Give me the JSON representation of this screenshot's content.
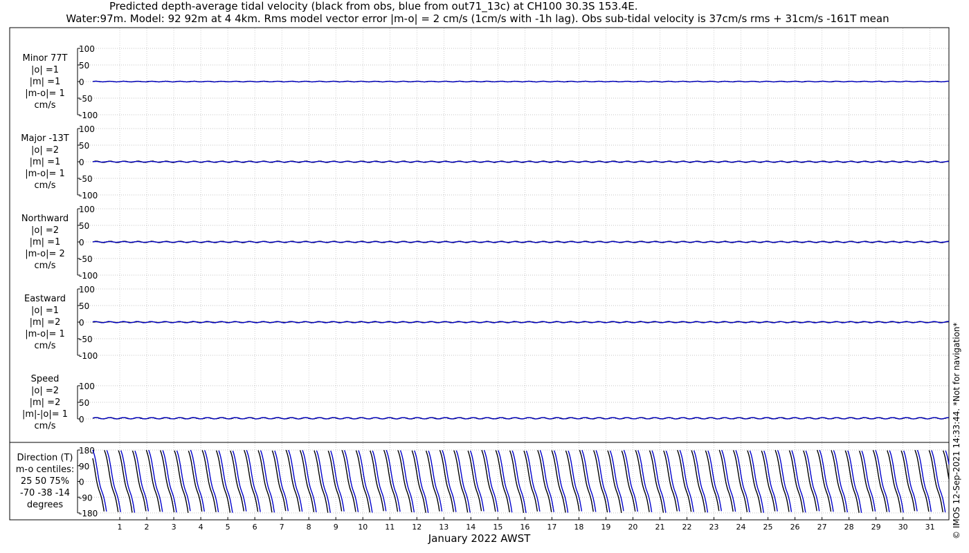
{
  "title_line1": "Predicted depth-average tidal velocity (black from obs, blue from out71_13c) at CH100 30.3S 153.4E.",
  "title_line2": "Water:97m. Model: 92 92m at 4 4km. Rms model vector error |m-o| = 2 cm/s (1cm/s with -1h lag). Obs sub-tidal velocity is 37cm/s rms + 31cm/s -161T mean",
  "copyright": "© IMOS 12-Sep-2021 14:33:44. *Not for navigation*",
  "colors": {
    "obs": "#000000",
    "model": "#0000cc",
    "grid": "#b0b0b0"
  },
  "chart_data": {
    "type": "line",
    "xlabel": "January 2022 AWST",
    "x_ticks": [
      "1",
      "2",
      "3",
      "4",
      "5",
      "6",
      "7",
      "8",
      "9",
      "10",
      "11",
      "12",
      "13",
      "14",
      "15",
      "16",
      "17",
      "18",
      "19",
      "20",
      "21",
      "22",
      "23",
      "24",
      "25",
      "26",
      "27",
      "28",
      "29",
      "30",
      "31"
    ],
    "xlim": [
      0.0,
      31.7
    ],
    "series_legend": [
      "obs",
      "out71_13c"
    ],
    "panels": [
      {
        "label": [
          "Minor 77T",
          "|o| =1",
          "|m| =1",
          "|m-o|= 1",
          "cm/s"
        ],
        "ylim": [
          -100,
          100
        ],
        "yticks": [
          "100",
          "50",
          "0",
          "-50",
          "-100"
        ],
        "amp_obs": 1,
        "amp_model": 1
      },
      {
        "label": [
          "Major -13T",
          "|o| =2",
          "|m| =1",
          "|m-o|= 1",
          "cm/s"
        ],
        "ylim": [
          -100,
          100
        ],
        "yticks": [
          "100",
          "50",
          "0",
          "-50",
          "-100"
        ],
        "amp_obs": 2,
        "amp_model": 1
      },
      {
        "label": [
          "Northward",
          "|o| =2",
          "|m| =1",
          "|m-o|= 2",
          "cm/s"
        ],
        "ylim": [
          -100,
          100
        ],
        "yticks": [
          "100",
          "50",
          "0",
          "-50",
          "-100"
        ],
        "amp_obs": 2,
        "amp_model": 1
      },
      {
        "label": [
          "Eastward",
          "|o| =1",
          "|m| =2",
          "|m-o|= 1",
          "cm/s"
        ],
        "ylim": [
          -100,
          100
        ],
        "yticks": [
          "100",
          "50",
          "0",
          "-50",
          "-100"
        ],
        "amp_obs": 1,
        "amp_model": 2
      },
      {
        "label": [
          "Speed",
          "|o| =2",
          "|m| =2",
          "|m|-|o|= 1",
          "cm/s"
        ],
        "ylim": [
          0,
          100
        ],
        "yticks": [
          "100",
          "50",
          "0"
        ],
        "amp_obs": 2,
        "amp_model": 2
      },
      {
        "label": [
          "Direction (T)",
          "m-o centiles:",
          "25  50  75%",
          "-70 -38 -14",
          "degrees"
        ],
        "ylim": [
          -180,
          180
        ],
        "yticks": [
          "180",
          "90",
          "0",
          "-90",
          "-180"
        ],
        "direction": true,
        "centiles": [
          -70,
          -38,
          -14
        ]
      }
    ]
  }
}
